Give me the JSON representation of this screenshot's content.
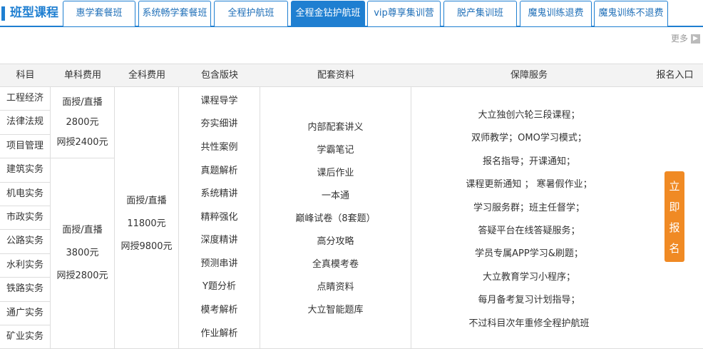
{
  "header": {
    "brand": "班型课程",
    "tabs": [
      {
        "label": "惠学套餐班",
        "active": false
      },
      {
        "label": "系统畅学套餐班",
        "active": false
      },
      {
        "label": "全程护航班",
        "active": false
      },
      {
        "label": "全程金钻护航班",
        "active": true
      },
      {
        "label": "vip尊享集训营",
        "active": false
      },
      {
        "label": "脱产集训班",
        "active": false
      },
      {
        "label": "魔鬼训练退费",
        "active": false
      },
      {
        "label": "魔鬼训练不退费",
        "active": false
      }
    ],
    "more_label": "更多",
    "accent_color": "#1f7fd1"
  },
  "table": {
    "columns": [
      "科目",
      "单科费用",
      "全科费用",
      "包含版块",
      "配套资料",
      "保障服务",
      "报名入口"
    ],
    "subjects": [
      "工程经济",
      "法律法规",
      "项目管理",
      "建筑实务",
      "机电实务",
      "市政实务",
      "公路实务",
      "水利实务",
      "铁路实务",
      "通广实务",
      "矿业实务"
    ],
    "single_fee_a": [
      "面授/直播",
      "2800元",
      "网授2400元"
    ],
    "single_fee_b": [
      "面授/直播",
      "3800元",
      "网授2800元"
    ],
    "full_fee": [
      "面授/直播",
      "11800元",
      "网授9800元"
    ],
    "modules": [
      "课程导学",
      "夯实细讲",
      "共性案例",
      "真题解析",
      "系统精讲",
      "精粹强化",
      "深度精讲",
      "预测串讲",
      "Y题分析",
      "模考解析",
      "作业解析"
    ],
    "materials": [
      "内部配套讲义",
      "学霸笔记",
      "课后作业",
      "一本通",
      "巅峰试卷（8套题）",
      "高分攻略",
      "全真模考卷",
      "点睛资料",
      "大立智能题库"
    ],
    "services": [
      "大立独创六轮三段课程；",
      "双师教学；OMO学习模式；",
      "报名指导；开课通知；",
      "课程更新通知 ； 寒暑假作业；",
      "学习服务群；班主任督学；",
      "答疑平台在线答疑服务；",
      "学员专属APP学习&刷题；",
      "大立教育学习小程序；",
      "每月备考复习计划指导；",
      "不过科目次年重修全程护航班"
    ],
    "signup_chars": [
      "立",
      "即",
      "报",
      "名"
    ],
    "signup_color": "#f08a24"
  }
}
